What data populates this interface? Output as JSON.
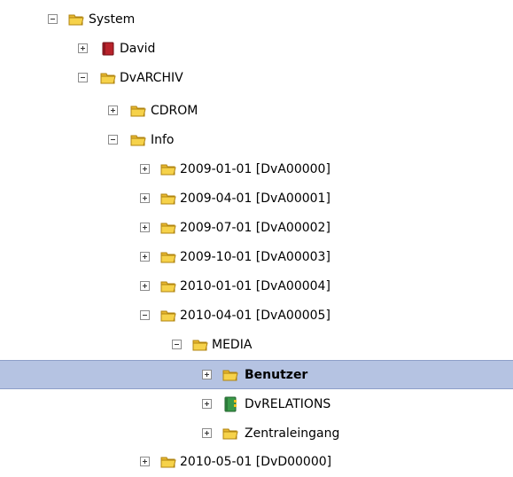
{
  "tree": {
    "nodes": [
      {
        "label": "System",
        "expander": "minus",
        "icon": "folder-icon"
      },
      {
        "label": "David",
        "expander": "plus",
        "icon": "red-book-icon"
      },
      {
        "label": "DvARCHIV",
        "expander": "minus",
        "icon": "folder-icon"
      },
      {
        "label": "CDROM",
        "expander": "plus",
        "icon": "folder-icon"
      },
      {
        "label": "Info",
        "expander": "minus",
        "icon": "folder-icon"
      },
      {
        "label": "2009-01-01 [DvA00000]",
        "expander": "plus",
        "icon": "folder-icon"
      },
      {
        "label": "2009-04-01 [DvA00001]",
        "expander": "plus",
        "icon": "folder-icon"
      },
      {
        "label": "2009-07-01 [DvA00002]",
        "expander": "plus",
        "icon": "folder-icon"
      },
      {
        "label": "2009-10-01 [DvA00003]",
        "expander": "plus",
        "icon": "folder-icon"
      },
      {
        "label": "2010-01-01 [DvA00004]",
        "expander": "plus",
        "icon": "folder-icon"
      },
      {
        "label": "2010-04-01 [DvA00005]",
        "expander": "minus",
        "icon": "folder-icon"
      },
      {
        "label": "MEDIA",
        "expander": "minus",
        "icon": "folder-icon"
      },
      {
        "label": "Benutzer",
        "expander": "plus",
        "icon": "folder-icon",
        "selected": true
      },
      {
        "label": "DvRELATIONS",
        "expander": "plus",
        "icon": "green-book-icon"
      },
      {
        "label": "Zentraleingang",
        "expander": "plus",
        "icon": "folder-icon"
      },
      {
        "label": "2010-05-01 [DvD00000]",
        "expander": "plus",
        "icon": "folder-icon"
      }
    ]
  },
  "colors": {
    "selection": "#b5c3e2",
    "folder": "#f6d24a",
    "red_book": "#b8222a",
    "green_book": "#3a9a4a"
  }
}
